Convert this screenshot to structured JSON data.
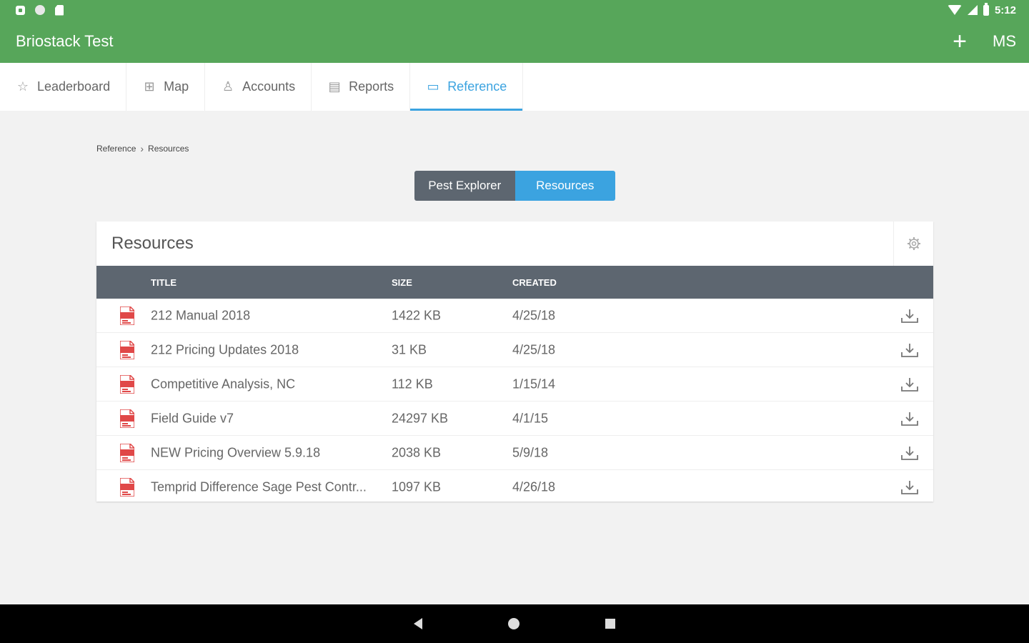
{
  "status_bar": {
    "time": "5:12",
    "icons": [
      "notification-icon",
      "circle-icon",
      "sd-card-icon",
      "wifi-icon",
      "signal-icon",
      "battery-icon"
    ]
  },
  "app_bar": {
    "title": "Briostack Test",
    "add_label": "+",
    "user_initials": "MS"
  },
  "tabs": [
    {
      "label": "Leaderboard",
      "icon": "star-icon",
      "glyph": "☆"
    },
    {
      "label": "Map",
      "icon": "map-icon",
      "glyph": "⊞"
    },
    {
      "label": "Accounts",
      "icon": "people-icon",
      "glyph": "♙"
    },
    {
      "label": "Reports",
      "icon": "report-icon",
      "glyph": "▤"
    },
    {
      "label": "Reference",
      "icon": "folder-icon",
      "glyph": "▭"
    }
  ],
  "breadcrumb": {
    "root": "Reference",
    "separator": "›",
    "current": "Resources"
  },
  "segmented": {
    "pest_explorer": "Pest Explorer",
    "resources": "Resources"
  },
  "resources_card": {
    "title": "Resources",
    "columns": {
      "title": "TITLE",
      "size": "SIZE",
      "created": "CREATED"
    },
    "rows": [
      {
        "title": "212 Manual 2018",
        "size": "1422 KB",
        "created": "4/25/18"
      },
      {
        "title": "212 Pricing Updates 2018",
        "size": "31 KB",
        "created": "4/25/18"
      },
      {
        "title": "Competitive Analysis, NC",
        "size": "112 KB",
        "created": "1/15/14"
      },
      {
        "title": "Field Guide v7",
        "size": "24297 KB",
        "created": "4/1/15"
      },
      {
        "title": "NEW Pricing Overview 5.9.18",
        "size": "2038 KB",
        "created": "5/9/18"
      },
      {
        "title": "Temprid Difference Sage Pest Contr...",
        "size": "1097 KB",
        "created": "4/26/18"
      }
    ]
  },
  "colors": {
    "brand_green": "#57a65a",
    "accent_blue": "#3ba3e0",
    "header_gray": "#5d6670",
    "pdf_red": "#e04848"
  }
}
